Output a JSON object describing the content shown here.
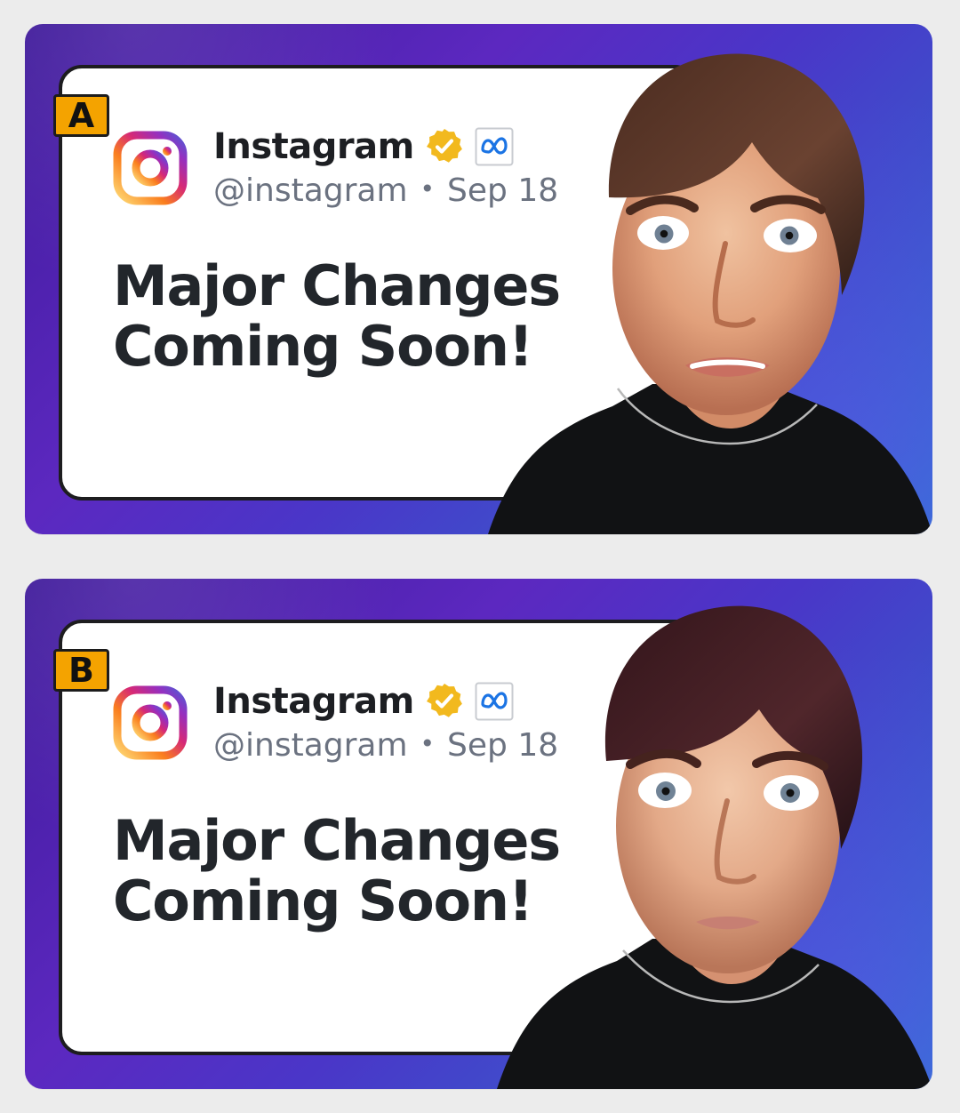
{
  "variants": [
    {
      "badge": "A",
      "account": {
        "name": "Instagram",
        "handle": "@instagram",
        "date": "Sep 18",
        "separator": "•"
      },
      "headline": "Major Changes\nComing Soon!"
    },
    {
      "badge": "B",
      "account": {
        "name": "Instagram",
        "handle": "@instagram",
        "date": "Sep 18",
        "separator": "•"
      },
      "headline": "Major Changes\nComing Soon!"
    }
  ],
  "colors": {
    "page_bg": "#ececec",
    "panel_purple": "#5c28c0",
    "panel_blue": "#2b74d0",
    "badge_yellow": "#f4a300",
    "text_dark": "#22262b",
    "text_gray": "#6b7280",
    "verified_gold": "#f2b91e",
    "meta_blue": "#1b74e4"
  },
  "icons": {
    "instagram": "instagram-logo-icon",
    "verified": "verified-badge-icon",
    "meta": "meta-logo-icon"
  }
}
